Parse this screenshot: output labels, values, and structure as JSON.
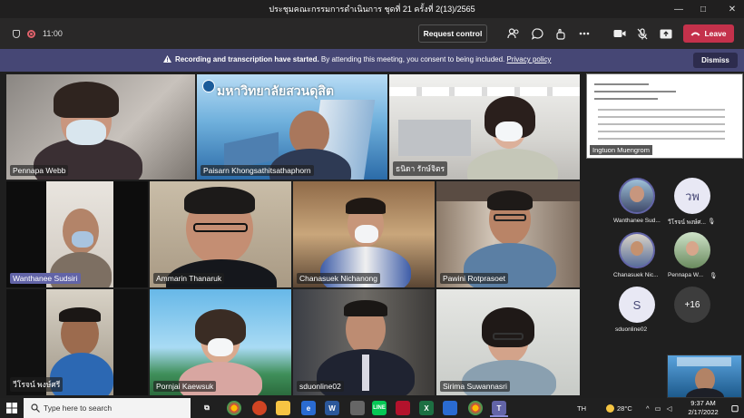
{
  "window": {
    "title": "ประชุมคณะกรรมการดำเนินการ ชุดที่ 21 ครั้งที่ 2(13)/2565",
    "controls": [
      "—",
      "□",
      "✕"
    ]
  },
  "toolbar": {
    "time": "11:00",
    "request_control": "Request control",
    "leave": "Leave"
  },
  "banner": {
    "bold": "Recording and transcription have started.",
    "text": " By attending this meeting, you consent to being included. ",
    "link": "Privacy policy",
    "dismiss": "Dismiss"
  },
  "participants": [
    {
      "name": "Pennapa Webb"
    },
    {
      "name": "Paisarn Khongsathitsathaphorn"
    },
    {
      "name": "ธนิดา รักษ์จิตร"
    },
    {
      "name": "Wanthanee Sudsiri"
    },
    {
      "name": "Ammarin Thanaruk"
    },
    {
      "name": "Chanasuek Nichanong"
    },
    {
      "name": "Pawini Rotprasoet"
    },
    {
      "name": "วีโรจน์ พงษ์ศรี"
    },
    {
      "name": "Pornjai Kaewsuk"
    },
    {
      "name": "sduonline02"
    },
    {
      "name": "Sirima Suwannasri"
    }
  ],
  "video_banner_text": "มหาวิทยาลัยสวนดุสิต",
  "shared_screen": {
    "presenter": "Ingtuon Muengrom"
  },
  "roster": [
    {
      "name": "Wanthanee Sud...",
      "initials": ""
    },
    {
      "name": "วีโรจน์ พงษ์ศ...",
      "initials": "วพ"
    },
    {
      "name": "Chanasuek Nic...",
      "initials": ""
    },
    {
      "name": "Pennapa W...",
      "initials": ""
    },
    {
      "name": "sduonline02",
      "initials": "S"
    },
    {
      "name": "",
      "initials": "+16"
    }
  ],
  "taskbar": {
    "search_placeholder": "Type here to search",
    "weather": "28°C",
    "language": "TH",
    "time": "9:37 AM",
    "date": "2/17/2022"
  }
}
